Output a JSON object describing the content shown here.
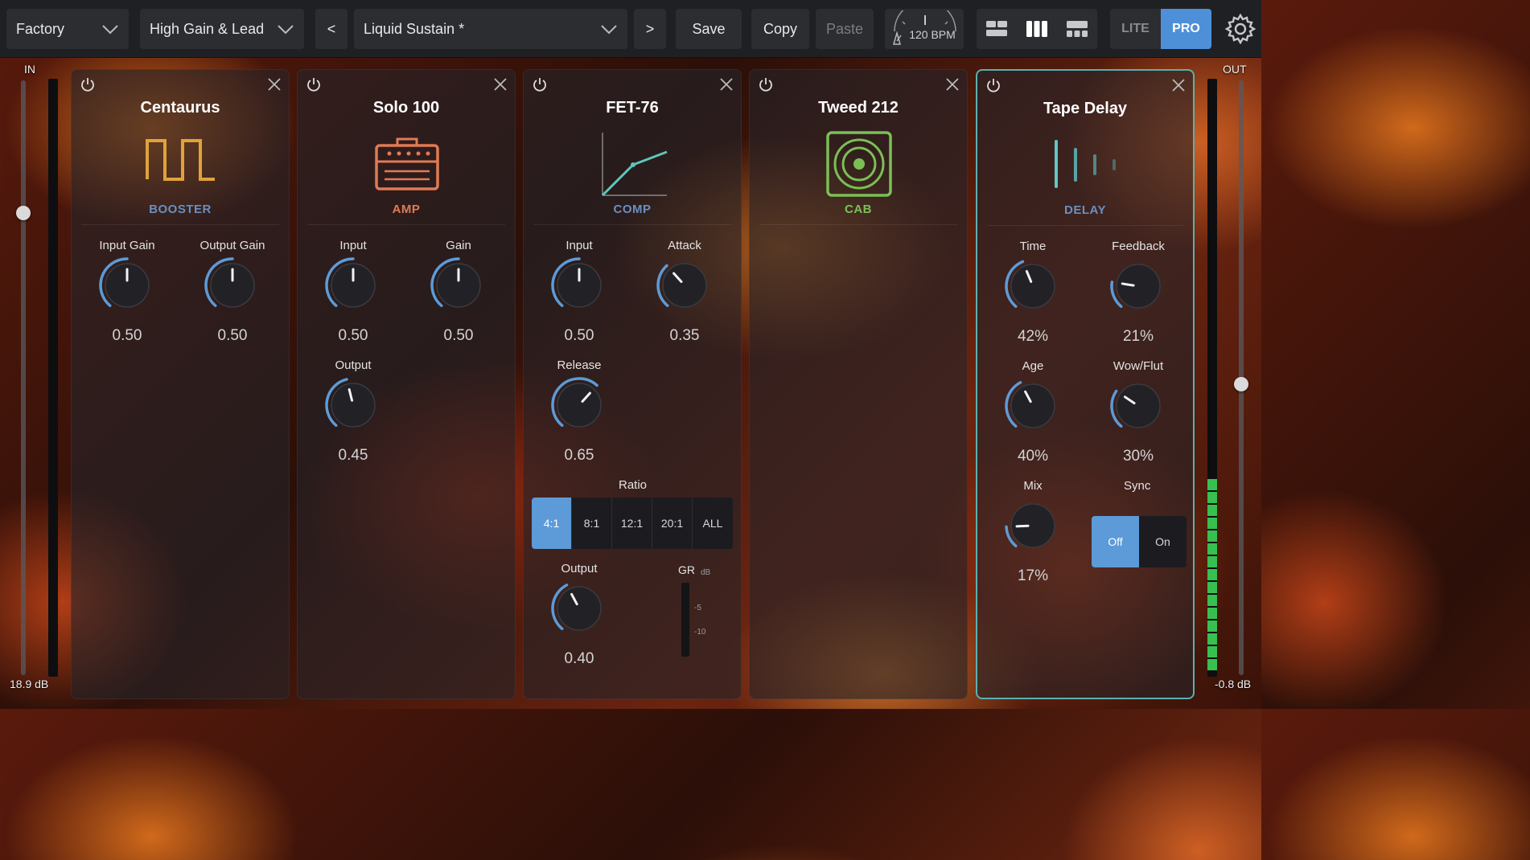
{
  "topbar": {
    "bank": "Factory",
    "category": "High Gain & Lead",
    "prev_label": "<",
    "preset": "Liquid Sustain *",
    "next_label": ">",
    "save_label": "Save",
    "copy_label": "Copy",
    "paste_label": "Paste",
    "bpm": "120 BPM",
    "lite_label": "LITE",
    "pro_label": "PRO"
  },
  "input_meter": {
    "label": "IN",
    "value": "18.9 dB"
  },
  "output_meter": {
    "label": "OUT",
    "value": "-0.8 dB"
  },
  "colors": {
    "accent": "#5c9bd8",
    "booster": "#6a8fc0",
    "amp": "#e07a55",
    "comp": "#6a8fc0",
    "cab": "#7ac055",
    "delay": "#6a8fc0",
    "meter_green": "#37c04f"
  },
  "panels": [
    {
      "title": "Centaurus",
      "category": "BOOSTER",
      "icon": "square-wave-icon",
      "knobs": [
        {
          "label": "Input Gain",
          "value": "0.50",
          "level": 0.5
        },
        {
          "label": "Output Gain",
          "value": "0.50",
          "level": 0.5
        }
      ]
    },
    {
      "title": "Solo 100",
      "category": "AMP",
      "icon": "amp-head-icon",
      "knobs": [
        {
          "label": "Input",
          "value": "0.50",
          "level": 0.5
        },
        {
          "label": "Gain",
          "value": "0.50",
          "level": 0.5
        },
        {
          "label": "Output",
          "value": "0.45",
          "level": 0.45
        }
      ]
    },
    {
      "title": "FET-76",
      "category": "COMP",
      "icon": "compressor-curve-icon",
      "knobs": [
        {
          "label": "Input",
          "value": "0.50",
          "level": 0.5
        },
        {
          "label": "Attack",
          "value": "0.35",
          "level": 0.35
        },
        {
          "label": "Release",
          "value": "0.65",
          "level": 0.65
        },
        {
          "label": "Output",
          "value": "0.40",
          "level": 0.4
        }
      ],
      "ratio_label": "Ratio",
      "ratio_options": [
        "4:1",
        "8:1",
        "12:1",
        "20:1",
        "ALL"
      ],
      "ratio_selected": "4:1",
      "gr_label": "GR",
      "gr_unit": "dB",
      "gr_ticks": [
        "-5",
        "-10"
      ]
    },
    {
      "title": "Tweed 212",
      "category": "CAB",
      "icon": "speaker-cab-icon",
      "knobs": []
    },
    {
      "title": "Tape Delay",
      "category": "DELAY",
      "icon": "tape-delay-icon",
      "knobs": [
        {
          "label": "Time",
          "value": "42%",
          "level": 0.42
        },
        {
          "label": "Feedback",
          "value": "21%",
          "level": 0.21
        },
        {
          "label": "Age",
          "value": "40%",
          "level": 0.4
        },
        {
          "label": "Wow/Flut",
          "value": "30%",
          "level": 0.3
        },
        {
          "label": "Mix",
          "value": "17%",
          "level": 0.17
        }
      ],
      "sync_label": "Sync",
      "sync_options": [
        "Off",
        "On"
      ],
      "sync_selected": "Off"
    }
  ]
}
